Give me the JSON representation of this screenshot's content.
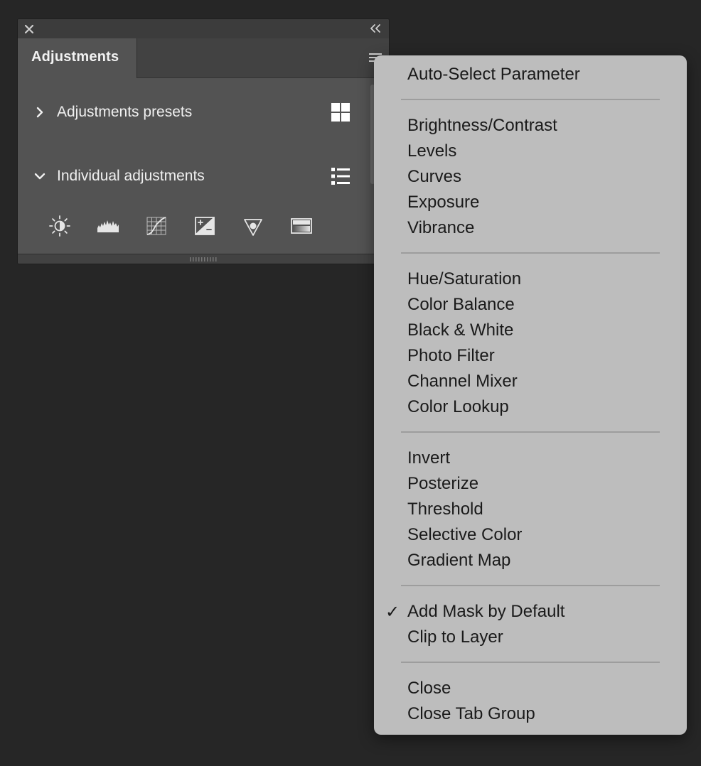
{
  "panel": {
    "tab_label": "Adjustments",
    "sections": [
      {
        "label": "Adjustments presets",
        "expanded": false,
        "action_icon": "grid-view-icon"
      },
      {
        "label": "Individual adjustments",
        "expanded": true,
        "action_icon": "list-view-icon"
      }
    ],
    "adjustment_icons": [
      "brightness-contrast-icon",
      "levels-icon",
      "curves-icon",
      "exposure-icon",
      "vibrance-icon",
      "hue-saturation-icon"
    ]
  },
  "menu": {
    "groups": [
      {
        "items": [
          {
            "label": "Auto-Select Parameter",
            "checked": false
          }
        ]
      },
      {
        "items": [
          {
            "label": "Brightness/Contrast",
            "checked": false
          },
          {
            "label": "Levels",
            "checked": false
          },
          {
            "label": "Curves",
            "checked": false
          },
          {
            "label": "Exposure",
            "checked": false
          },
          {
            "label": "Vibrance",
            "checked": false
          }
        ]
      },
      {
        "items": [
          {
            "label": "Hue/Saturation",
            "checked": false
          },
          {
            "label": "Color Balance",
            "checked": false
          },
          {
            "label": "Black & White",
            "checked": false
          },
          {
            "label": "Photo Filter",
            "checked": false
          },
          {
            "label": "Channel Mixer",
            "checked": false
          },
          {
            "label": "Color Lookup",
            "checked": false
          }
        ]
      },
      {
        "items": [
          {
            "label": "Invert",
            "checked": false
          },
          {
            "label": "Posterize",
            "checked": false
          },
          {
            "label": "Threshold",
            "checked": false
          },
          {
            "label": "Selective Color",
            "checked": false
          },
          {
            "label": "Gradient Map",
            "checked": false
          }
        ]
      },
      {
        "items": [
          {
            "label": "Add Mask by Default",
            "checked": true
          },
          {
            "label": "Clip to Layer",
            "checked": false
          }
        ]
      },
      {
        "items": [
          {
            "label": "Close",
            "checked": false
          },
          {
            "label": "Close Tab Group",
            "checked": false
          }
        ]
      }
    ],
    "check_glyph": "✓"
  },
  "colors": {
    "background": "#262626",
    "panel": "#535353",
    "menu": "#bdbdbd",
    "menu_text": "#1a1a1a",
    "panel_text": "#f0f0f0"
  }
}
